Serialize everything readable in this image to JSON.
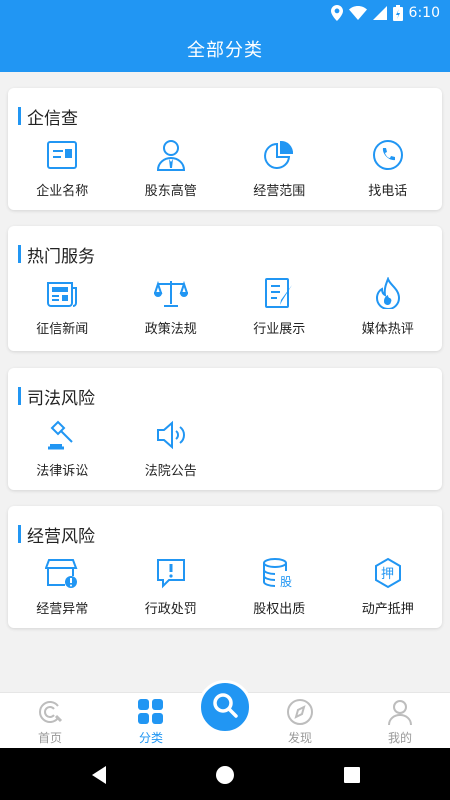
{
  "status_bar": {
    "time": "6:10"
  },
  "app_bar": {
    "title": "全部分类"
  },
  "sections": [
    {
      "title": "企信查",
      "items": [
        {
          "label": "企业名称",
          "icon": "id-card-icon"
        },
        {
          "label": "股东高管",
          "icon": "person-tie-icon"
        },
        {
          "label": "经营范围",
          "icon": "pie-chart-icon"
        },
        {
          "label": "找电话",
          "icon": "phone-icon"
        }
      ]
    },
    {
      "title": "热门服务",
      "items": [
        {
          "label": "征信新闻",
          "icon": "newspaper-icon"
        },
        {
          "label": "政策法规",
          "icon": "scales-icon"
        },
        {
          "label": "行业展示",
          "icon": "checklist-icon"
        },
        {
          "label": "媒体热评",
          "icon": "flame-icon"
        }
      ]
    },
    {
      "title": "司法风险",
      "items": [
        {
          "label": "法律诉讼",
          "icon": "gavel-icon"
        },
        {
          "label": "法院公告",
          "icon": "speaker-icon"
        }
      ]
    },
    {
      "title": "经营风险",
      "items": [
        {
          "label": "经营异常",
          "icon": "store-alert-icon"
        },
        {
          "label": "行政处罚",
          "icon": "alert-message-icon"
        },
        {
          "label": "股权出质",
          "icon": "database-share-icon",
          "glyph": "股"
        },
        {
          "label": "动产抵押",
          "icon": "pledge-badge-icon",
          "glyph": "押"
        }
      ]
    }
  ],
  "tabbar": {
    "active": "分类",
    "tabs": [
      {
        "label": "首页",
        "icon": "home-logo-icon"
      },
      {
        "label": "分类",
        "icon": "category-grid-icon"
      },
      {
        "label": "发现",
        "icon": "compass-icon"
      },
      {
        "label": "我的",
        "icon": "profile-icon"
      }
    ]
  },
  "colors": {
    "primary": "#2196f3",
    "inactive": "#999999",
    "text": "#222222"
  }
}
